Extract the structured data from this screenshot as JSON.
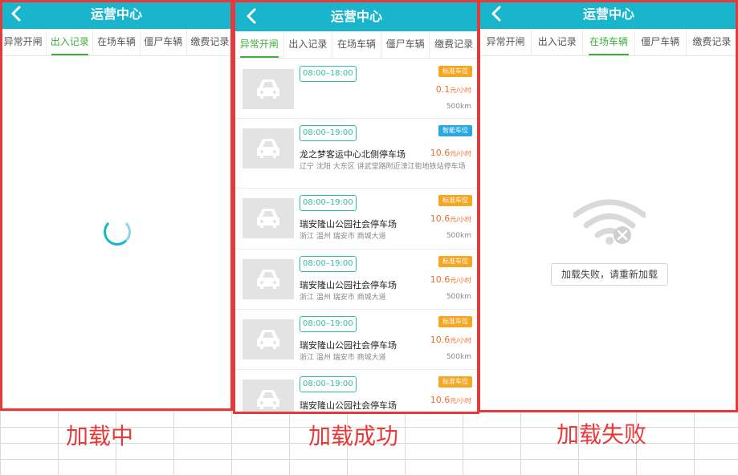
{
  "header_title": "运营中心",
  "tabs": [
    "异常开闸",
    "出入记录",
    "在场车辆",
    "僵尸车辆",
    "缴费记录"
  ],
  "panels": [
    {
      "active_tab": 1,
      "caption": "加载中"
    },
    {
      "active_tab": 0,
      "caption": "加载成功"
    },
    {
      "active_tab": 2,
      "caption": "加载失败"
    }
  ],
  "list_items": [
    {
      "time": "08:00–18:00",
      "badge": "标准车位",
      "badge_type": "standard",
      "name": "",
      "address": "",
      "price": "0.1",
      "price_unit": "元/小时",
      "distance": "500km"
    },
    {
      "time": "08:00–19:00",
      "badge": "智能车位",
      "badge_type": "smart",
      "name": "龙之梦客运中心北侧停车场",
      "address": "辽宁 沈阳 大东区 讲武堂路附近滂江街地铁站停车场",
      "price": "10.6",
      "price_unit": "元/小时",
      "distance": ""
    },
    {
      "time": "08:00–19:00",
      "badge": "标准车位",
      "badge_type": "standard",
      "name": "瑞安隆山公园社会停车场",
      "address": "浙江 温州 瑞安市 商城大道",
      "price": "10.6",
      "price_unit": "元/小时",
      "distance": "500km"
    },
    {
      "time": "08:00–19:00",
      "badge": "标准车位",
      "badge_type": "standard",
      "name": "瑞安隆山公园社会停车场",
      "address": "浙江 温州 瑞安市 商城大道",
      "price": "10.6",
      "price_unit": "元/小时",
      "distance": "500km"
    },
    {
      "time": "08:00–19:00",
      "badge": "标准车位",
      "badge_type": "standard",
      "name": "瑞安隆山公园社会停车场",
      "address": "浙江 温州 瑞安市 商城大道",
      "price": "10.6",
      "price_unit": "元/小时",
      "distance": "500km"
    },
    {
      "time": "08:00–19:00",
      "badge": "标准车位",
      "badge_type": "standard",
      "name": "瑞安隆山公园社会停车场",
      "address": "",
      "price": "10.6",
      "price_unit": "元/小时",
      "distance": ""
    }
  ],
  "error_state": {
    "retry_label": "加载失败，请重新加载",
    "icon": "wifi-off-icon"
  },
  "loading_state": {
    "icon": "loading-spinner-icon"
  },
  "colors": {
    "header": "#19b5cc",
    "active_tab": "#3fae3c",
    "frame": "#e63a3a",
    "price": "#f26b2a",
    "standard_badge": "#f5a623",
    "smart_badge": "#2aa8e0",
    "time_tag": "#2fbf9e"
  }
}
